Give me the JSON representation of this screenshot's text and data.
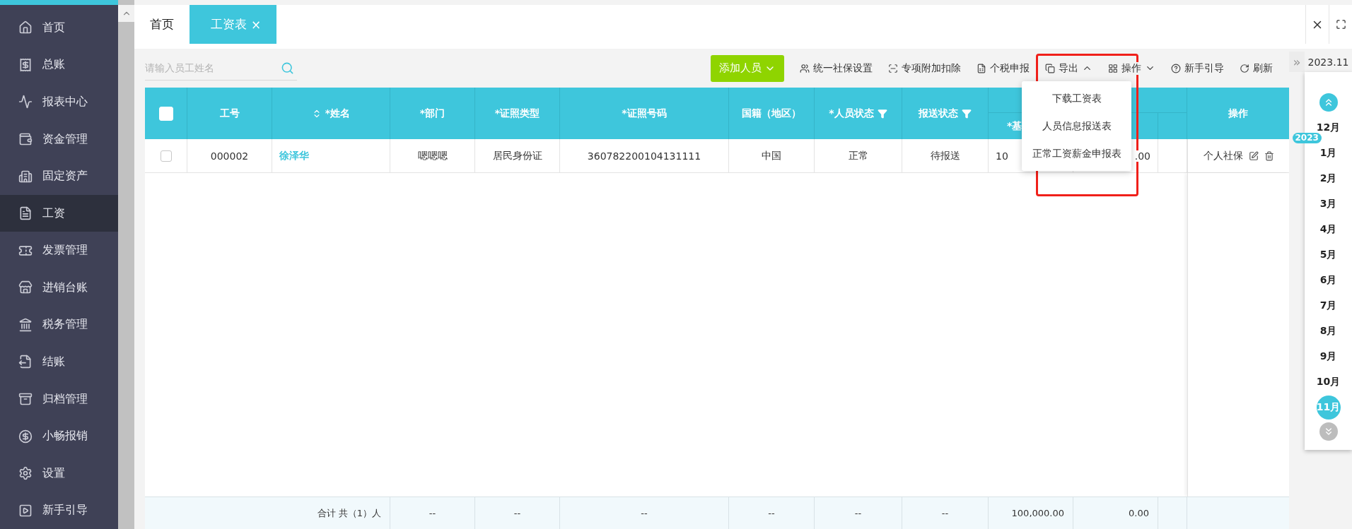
{
  "sidebar": {
    "items": [
      {
        "label": "首页",
        "selected": false
      },
      {
        "label": "总账",
        "selected": false
      },
      {
        "label": "报表中心",
        "selected": false
      },
      {
        "label": "资金管理",
        "selected": false
      },
      {
        "label": "固定资产",
        "selected": false
      },
      {
        "label": "工资",
        "selected": true
      },
      {
        "label": "发票管理",
        "selected": false
      },
      {
        "label": "进销台账",
        "selected": false
      },
      {
        "label": "税务管理",
        "selected": false
      },
      {
        "label": "结账",
        "selected": false
      },
      {
        "label": "归档管理",
        "selected": false
      },
      {
        "label": "小畅报销",
        "selected": false
      },
      {
        "label": "设置",
        "selected": false
      },
      {
        "label": "新手引导",
        "selected": false
      }
    ]
  },
  "tabs": [
    {
      "label": "首页",
      "selected": false
    },
    {
      "label": "工资表",
      "selected": true,
      "close": "×"
    }
  ],
  "search": {
    "placeholder": "请输入员工姓名"
  },
  "toolbar": {
    "add_button": "添加人员",
    "actions": [
      {
        "label": "统一社保设置"
      },
      {
        "label": "专项附加扣除"
      },
      {
        "label": "个税申报"
      },
      {
        "label": "导出",
        "expanded": true
      },
      {
        "label": "操作",
        "expanded": false
      },
      {
        "label": "新手引导"
      },
      {
        "label": "刷新"
      }
    ]
  },
  "export_menu": {
    "items": [
      "下载工资表",
      "人员信息报送表",
      "正常工资薪金申报表"
    ]
  },
  "table": {
    "header_checkbox": {
      "checked": false
    },
    "columns": [
      {
        "label": "工号",
        "kind": "plain"
      },
      {
        "label": "*姓名",
        "kind": "sortable"
      },
      {
        "label": "*部门",
        "kind": "plain"
      },
      {
        "label": "*证照类型",
        "kind": "plain"
      },
      {
        "label": "*证照号码",
        "kind": "plain"
      },
      {
        "label": "国籍（地区）",
        "kind": "plain"
      },
      {
        "label": "*人员状态",
        "kind": "filter"
      },
      {
        "label": "报送状态",
        "kind": "filter"
      }
    ],
    "sub_column": "*基",
    "action_column": "操作",
    "rows": [
      {
        "checked": false,
        "cells": [
          "000002",
          "徐泽华",
          "嗯嗯嗯",
          "居民身份证",
          "360782200104131111",
          "中国",
          "正常",
          "待报送"
        ],
        "partial": [
          "10",
          ".00"
        ],
        "action": "个人社保"
      }
    ],
    "footer": {
      "label": "合计 共（1）人",
      "values": [
        "--",
        "--",
        "--",
        "--",
        "--",
        "--",
        "100,000.00",
        "0.00"
      ]
    }
  },
  "months": {
    "current": "2023.11",
    "toggle": "»",
    "items": [
      {
        "label": "12月",
        "selected": false
      },
      {
        "label": "1月",
        "selected": false,
        "year_badge": "2023"
      },
      {
        "label": "2月",
        "selected": false
      },
      {
        "label": "3月",
        "selected": false
      },
      {
        "label": "4月",
        "selected": false
      },
      {
        "label": "5月",
        "selected": false
      },
      {
        "label": "6月",
        "selected": false
      },
      {
        "label": "7月",
        "selected": false
      },
      {
        "label": "8月",
        "selected": false
      },
      {
        "label": "9月",
        "selected": false
      },
      {
        "label": "10月",
        "selected": false
      },
      {
        "label": "11月",
        "selected": true
      }
    ]
  }
}
